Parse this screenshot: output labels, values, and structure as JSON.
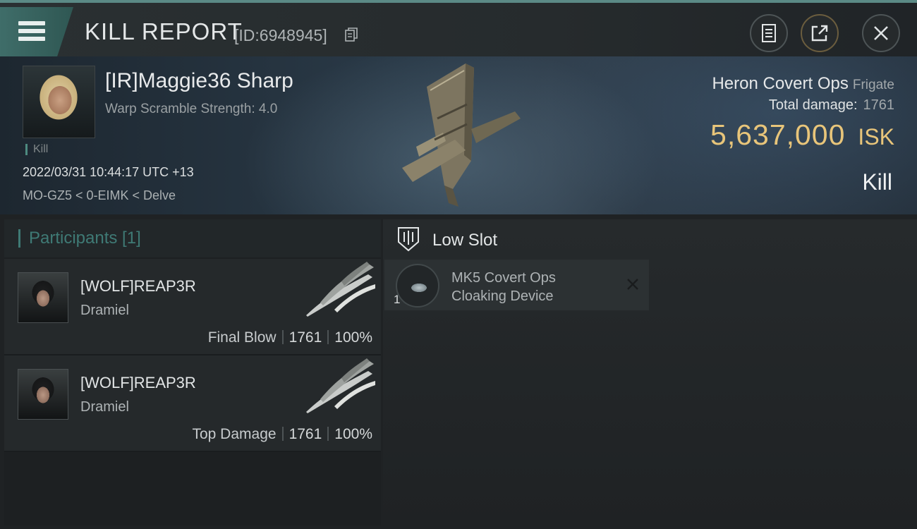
{
  "header": {
    "title": "KILL REPORT",
    "report_id": "[ID:6948945]"
  },
  "victim": {
    "pilot_name": "[IR]Maggie36 Sharp",
    "warp_scramble": "Warp Scramble Strength: 4.0",
    "tag": "Kill",
    "datetime": "2022/03/31 10:44:17 UTC +13",
    "location": "MO-GZ5 < 0-EIMK < Delve",
    "ship_name": "Heron Covert Ops",
    "ship_class": "Frigate",
    "total_damage_label": "Total damage:",
    "total_damage": "1761",
    "isk_value": "5,637,000",
    "isk_unit": "ISK",
    "result": "Kill"
  },
  "participants": {
    "title": "Participants [1]",
    "rows": [
      {
        "name": "[WOLF]REAP3R",
        "ship": "Dramiel",
        "role": "Final Blow",
        "damage": "1761",
        "percent": "100%"
      },
      {
        "name": "[WOLF]REAP3R",
        "ship": "Dramiel",
        "role": "Top Damage",
        "damage": "1761",
        "percent": "100%"
      }
    ]
  },
  "slots": {
    "title": "Low Slot",
    "modules": [
      {
        "qty": "1",
        "name_line1": "MK5 Covert Ops",
        "name_line2": "Cloaking Device"
      }
    ]
  },
  "colors": {
    "accent": "#3f7a75",
    "isk_gold": "#e8c57a",
    "background": "#1f2224"
  },
  "icons": [
    "menu-icon",
    "copy-icon",
    "report-icon",
    "share-icon",
    "close-icon",
    "low-slot-icon",
    "remove-icon"
  ]
}
